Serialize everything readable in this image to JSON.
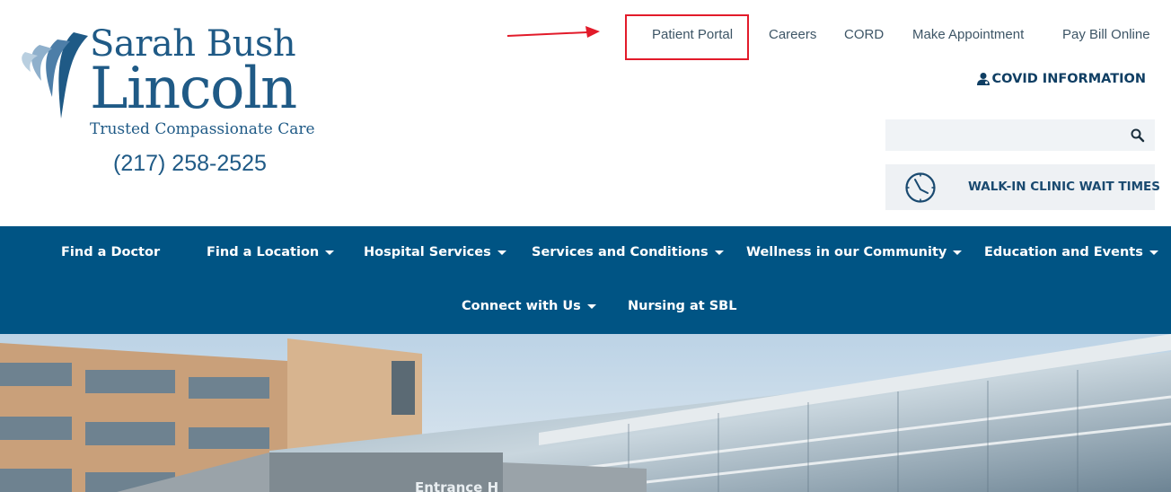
{
  "logo": {
    "line1": "Sarah Bush",
    "line2": "Lincoln",
    "tagline": "Trusted Compassionate Care"
  },
  "phone": "(217) 258-2525",
  "top_links": [
    {
      "label": "Patient Portal",
      "icon": ""
    },
    {
      "label": "Careers",
      "icon": ""
    },
    {
      "label": "CORD",
      "icon": ""
    },
    {
      "label": "Make Appointment",
      "icon": ""
    },
    {
      "label": "Pay Bill Online",
      "icon": ""
    }
  ],
  "covid": {
    "label": "COVID INFORMATION",
    "icon": "person-icon"
  },
  "search": {
    "placeholder": "",
    "value": "",
    "icon": "search-icon"
  },
  "walkin": {
    "label": "WALK-IN CLINIC WAIT TIMES",
    "icon": "clock-icon"
  },
  "nav": {
    "row1": [
      {
        "label": "Find a Doctor",
        "dropdown": false
      },
      {
        "label": "Find a Location",
        "dropdown": true
      },
      {
        "label": "Hospital Services",
        "dropdown": true
      },
      {
        "label": "Services and Conditions",
        "dropdown": true
      },
      {
        "label": "Wellness in our Community",
        "dropdown": true
      },
      {
        "label": "Education and Events",
        "dropdown": true
      }
    ],
    "row2": [
      {
        "label": "Connect with Us",
        "dropdown": true
      },
      {
        "label": "Nursing at SBL",
        "dropdown": false
      }
    ]
  },
  "hero": {
    "sign_text": "Entrance H"
  },
  "colors": {
    "brand_blue": "#1f5a86",
    "nav_bg": "#005484",
    "annotation_red": "#e21b2a"
  }
}
